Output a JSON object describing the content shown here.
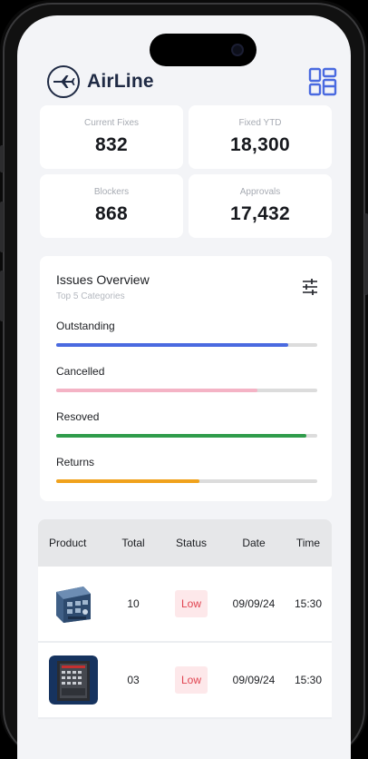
{
  "app": {
    "name": "AirLine"
  },
  "stats": [
    {
      "label": "Current Fixes",
      "value": "832"
    },
    {
      "label": "Fixed YTD",
      "value": "18,300"
    },
    {
      "label": "Blockers",
      "value": "868"
    },
    {
      "label": "Approvals",
      "value": "17,432"
    }
  ],
  "issues": {
    "title": "Issues Overview",
    "subtitle": "Top 5 Categories",
    "items": [
      {
        "label": "Outstanding",
        "progress": 0.89,
        "color": "#4a6ae0"
      },
      {
        "label": "Cancelled",
        "progress": 0.77,
        "color": "#f4b3c5"
      },
      {
        "label": "Resoved",
        "progress": 0.96,
        "color": "#2f9c4b"
      },
      {
        "label": "Returns",
        "progress": 0.55,
        "color": "#f0a21c"
      }
    ]
  },
  "table": {
    "headers": [
      "Product",
      "Total",
      "Status",
      "Date",
      "Time"
    ],
    "rows": [
      {
        "total": "10",
        "status": "Low",
        "date": "09/09/24",
        "time": "15:30"
      },
      {
        "total": "03",
        "status": "Low",
        "date": "09/09/24",
        "time": "15:30"
      }
    ]
  },
  "colors": {
    "accent": "#4a6ae0",
    "brand": "#1f2a44",
    "status_low_bg": "#fde8ea",
    "status_low_text": "#e0434f"
  }
}
